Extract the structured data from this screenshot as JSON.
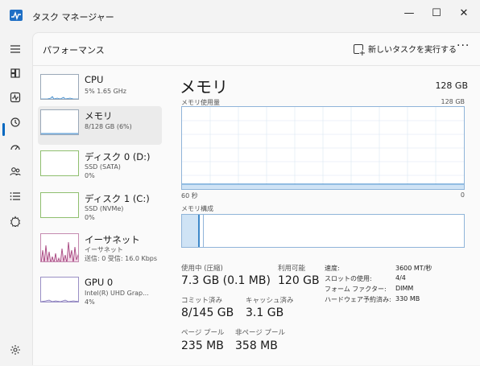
{
  "window": {
    "title": "タスク マネージャー",
    "min_glyph": "—",
    "max_glyph": "☐",
    "close_glyph": "✕"
  },
  "nav": {
    "icons": [
      "hamburger-icon",
      "processes-icon",
      "performance-icon",
      "app-history-icon",
      "startup-icon",
      "users-icon",
      "details-icon",
      "services-icon",
      "settings-icon"
    ],
    "active": "performance-icon"
  },
  "header": {
    "title": "パフォーマンス",
    "new_task": "新しいタスクを実行する",
    "more": "···"
  },
  "items": [
    {
      "name": "CPU",
      "sub1": "5%  1.65 GHz",
      "sub2": "",
      "sub3": ""
    },
    {
      "name": "メモリ",
      "sub1": "8/128 GB (6%)",
      "sub2": "",
      "sub3": ""
    },
    {
      "name": "ディスク 0 (D:)",
      "sub1": "SSD (SATA)",
      "sub2": "0%",
      "sub3": ""
    },
    {
      "name": "ディスク 1 (C:)",
      "sub1": "SSD (NVMe)",
      "sub2": "0%",
      "sub3": ""
    },
    {
      "name": "イーサネット",
      "sub1": "イーサネット",
      "sub2": "送信: 0 受信: 16.0 Kbps",
      "sub3": ""
    },
    {
      "name": "GPU 0",
      "sub1": "Intel(R) UHD Grap...",
      "sub2": "4%",
      "sub3": ""
    }
  ],
  "detail": {
    "title": "メモリ",
    "total": "128 GB",
    "usage_label": "メモリ使用量",
    "usage_max": "128 GB",
    "time_left": "60 秒",
    "time_right": "0",
    "composition_label": "メモリ構成",
    "usage_level": 0.06,
    "stats": {
      "in_use_label": "使用中 (圧縮)",
      "in_use_value": "7.3 GB (0.1 MB)",
      "available_label": "利用可能",
      "available_value": "120 GB",
      "committed_label": "コミット済み",
      "committed_value": "8/145 GB",
      "cached_label": "キャッシュ済み",
      "cached_value": "3.1 GB",
      "paged_label": "ページ プール",
      "paged_value": "235 MB",
      "nonpaged_label": "非ページ プール",
      "nonpaged_value": "358 MB"
    },
    "kv": [
      {
        "label": "速度:",
        "value": "3600 MT/秒"
      },
      {
        "label": "スロットの使用:",
        "value": "4/4"
      },
      {
        "label": "フォーム ファクター:",
        "value": "DIMM"
      },
      {
        "label": "ハードウェア予約済み:",
        "value": "330 MB"
      }
    ]
  },
  "colors": {
    "accent": "#0067c0",
    "memory_line": "#8fb4d9",
    "memory_fill": "#cfe3f5",
    "ethernet": "#a7457f",
    "cpu": "#3d88c9"
  }
}
